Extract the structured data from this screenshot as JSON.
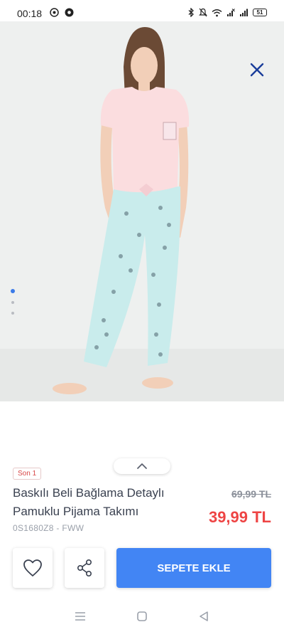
{
  "status_bar": {
    "time": "00:18",
    "battery": "51",
    "icons": [
      "whatsapp-icon",
      "chrome-icon",
      "bluetooth-icon",
      "mute-icon",
      "wifi-icon",
      "signal-x-icon",
      "signal-icon",
      "battery-icon"
    ]
  },
  "gallery": {
    "image_count": 3,
    "active_index": 0,
    "close_icon": "close-icon",
    "colors": {
      "shirt": "#fbdddf",
      "pants": "#c9ecec",
      "background": "#eef0ef",
      "hair": "#6b4a35",
      "skin": "#f2cfb8"
    }
  },
  "product": {
    "stock_badge": "Son 1",
    "title": "Baskılı Beli Bağlama Detaylı Pamuklu Pijama Takımı",
    "old_price": "69,99 TL",
    "new_price": "39,99 TL",
    "code": "0S1680Z8 - FWW"
  },
  "actions": {
    "favorite_icon": "heart-icon",
    "share_icon": "share-icon",
    "add_to_cart_label": "SEPETE EKLE"
  },
  "colors": {
    "accent": "#4285f4",
    "price_red": "#ee4444",
    "text": "#3a4150",
    "close_blue": "#1a3d9a"
  },
  "system_nav": [
    "menu-icon",
    "home-icon",
    "back-icon"
  ]
}
